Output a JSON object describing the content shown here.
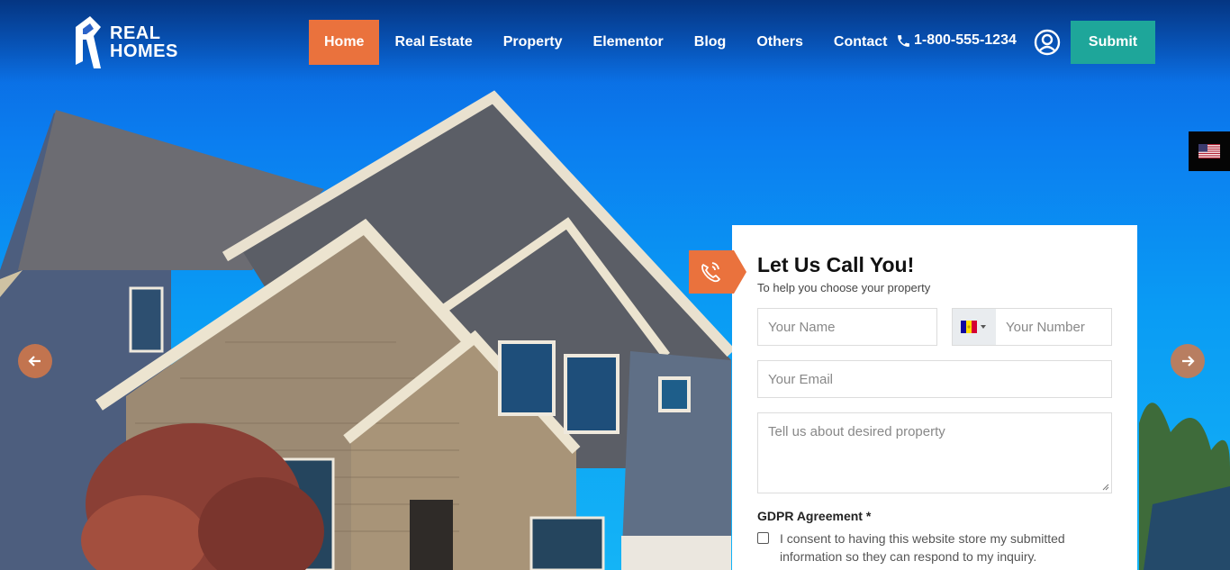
{
  "brand": {
    "line1": "REAL",
    "line2": "HOMES"
  },
  "nav": {
    "items": [
      {
        "label": "Home",
        "active": true
      },
      {
        "label": "Real Estate",
        "active": false
      },
      {
        "label": "Property",
        "active": false
      },
      {
        "label": "Elementor",
        "active": false
      },
      {
        "label": "Blog",
        "active": false
      },
      {
        "label": "Others",
        "active": false
      },
      {
        "label": "Contact",
        "active": false
      }
    ],
    "phone": "1-800-555-1234",
    "submit_label": "Submit"
  },
  "language": {
    "flag": "us-flag-icon"
  },
  "form": {
    "title": "Let Us Call You!",
    "subtitle": "To help you choose your property",
    "name_placeholder": "Your Name",
    "number_placeholder": "Your Number",
    "email_placeholder": "Your Email",
    "message_placeholder": "Tell us about desired property",
    "country_flag": "andorra-flag-icon",
    "gdpr_label": "GDPR Agreement *",
    "gdpr_text": "I consent to having this website store my submitted information so they can respond to my inquiry."
  },
  "colors": {
    "accent": "#ea723d",
    "submit": "#1ea69a",
    "sky": "#0a9cf4"
  }
}
